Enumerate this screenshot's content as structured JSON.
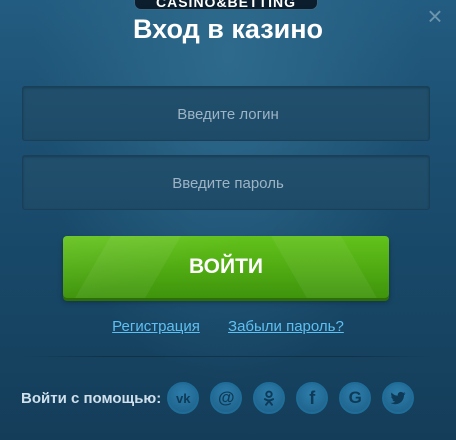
{
  "brand": {
    "badge_text": "CASINO&BETTING"
  },
  "dialog": {
    "title": "Вход в казино",
    "close_icon": "close-icon"
  },
  "form": {
    "login_placeholder": "Введите логин",
    "login_value": "",
    "password_placeholder": "Введите пароль",
    "password_value": "",
    "submit_label": "ВОЙТИ"
  },
  "links": {
    "register": "Регистрация",
    "forgot_password": "Забыли пароль?"
  },
  "social": {
    "label": "Войти с помощью:",
    "providers": [
      {
        "name": "vk",
        "icon": "vk-icon",
        "text": "vk"
      },
      {
        "name": "mail",
        "icon": "at-sign-icon",
        "text": "@"
      },
      {
        "name": "odnoklassniki",
        "icon": "odnoklassniki-icon"
      },
      {
        "name": "facebook",
        "icon": "facebook-icon",
        "text": "f"
      },
      {
        "name": "google",
        "icon": "google-icon",
        "text": "G"
      },
      {
        "name": "twitter",
        "icon": "twitter-icon"
      }
    ]
  },
  "colors": {
    "background": "#1b4e70",
    "button_green": "#4faa12",
    "link": "#5ec0f2",
    "social_circle": "#1f6d99"
  }
}
